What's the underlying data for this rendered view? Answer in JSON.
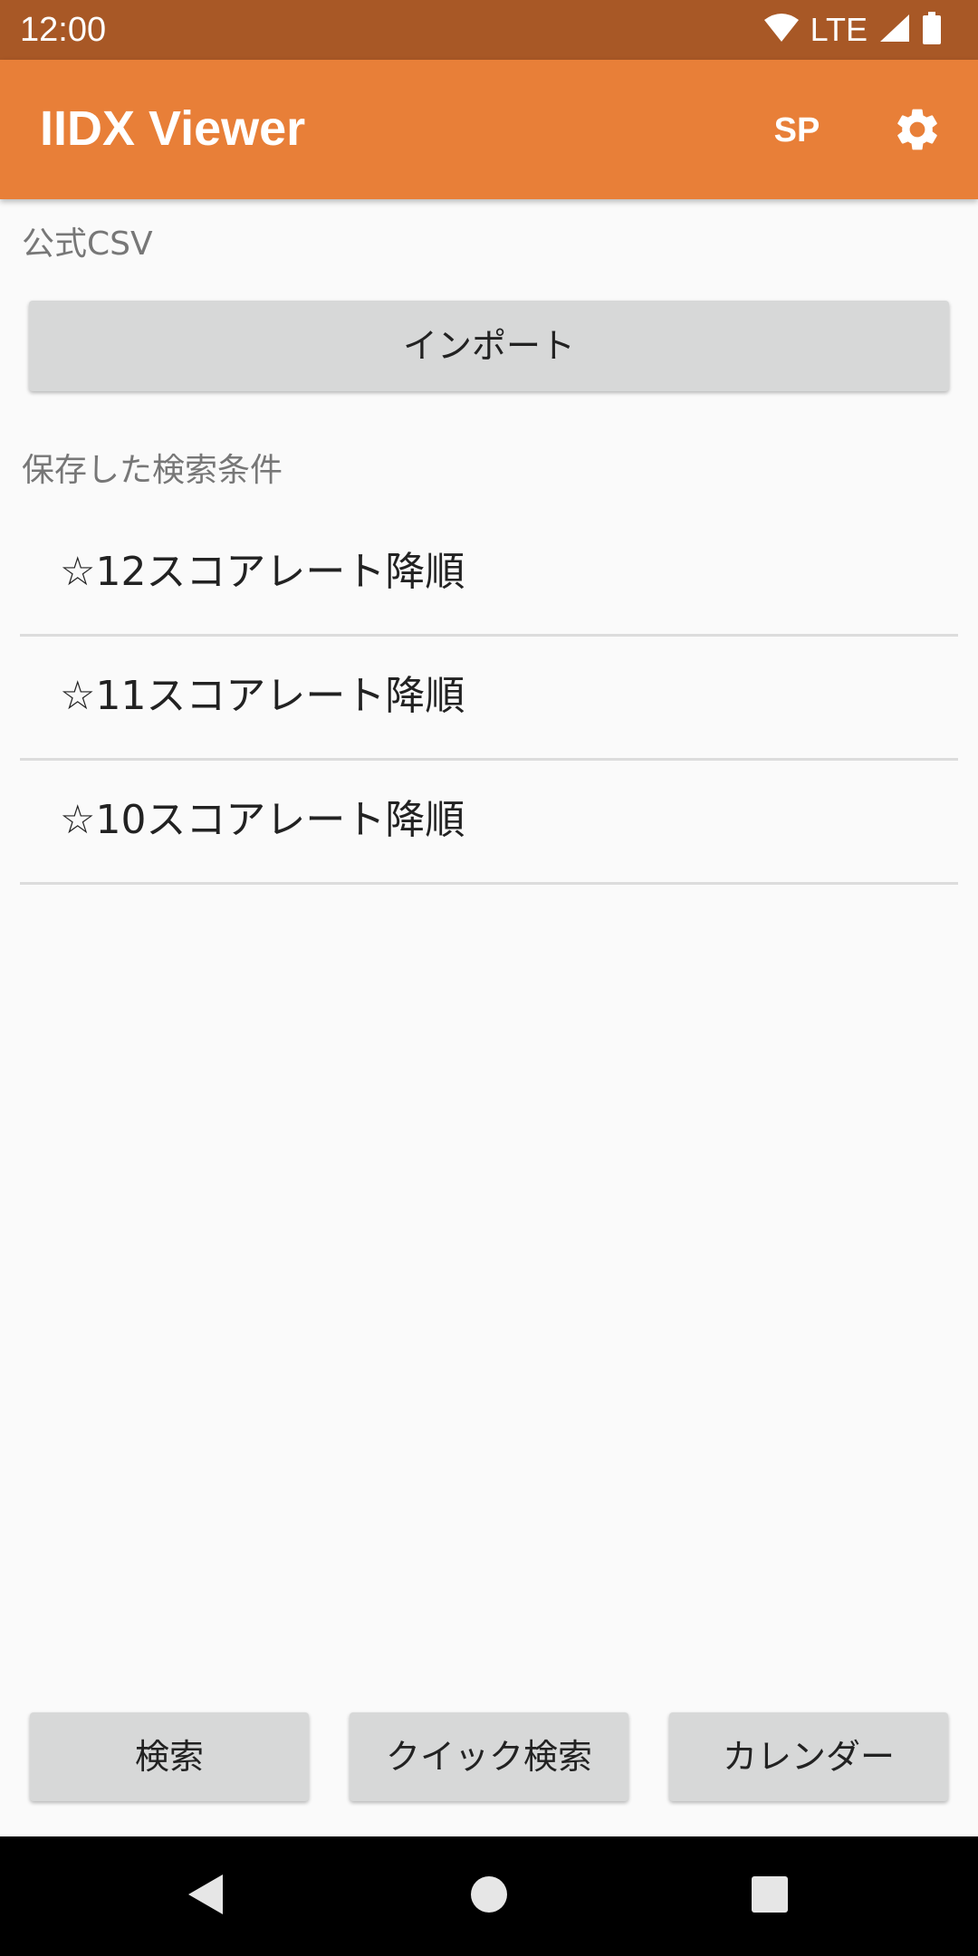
{
  "status_bar": {
    "time": "12:00",
    "network": "LTE",
    "icons": [
      "wifi-icon",
      "signal-icon",
      "battery-icon"
    ]
  },
  "app_bar": {
    "title": "IIDX Viewer",
    "mode_label": "SP",
    "settings_icon": "gear-icon"
  },
  "official_csv": {
    "section_label": "公式CSV",
    "import_label": "インポート"
  },
  "saved_searches": {
    "section_label": "保存した検索条件",
    "items": [
      {
        "label": "☆12スコアレート降順"
      },
      {
        "label": "☆11スコアレート降順"
      },
      {
        "label": "☆10スコアレート降順"
      }
    ]
  },
  "bottom_buttons": {
    "search": "検索",
    "quick_search": "クイック検索",
    "calendar": "カレンダー"
  },
  "nav_bar": {
    "icons": [
      "back-icon",
      "home-icon",
      "recents-icon"
    ]
  },
  "colors": {
    "status_bar": "#a85826",
    "app_bar": "#e87f38",
    "button_bg": "#d7d8d8",
    "background": "#fafafa"
  }
}
